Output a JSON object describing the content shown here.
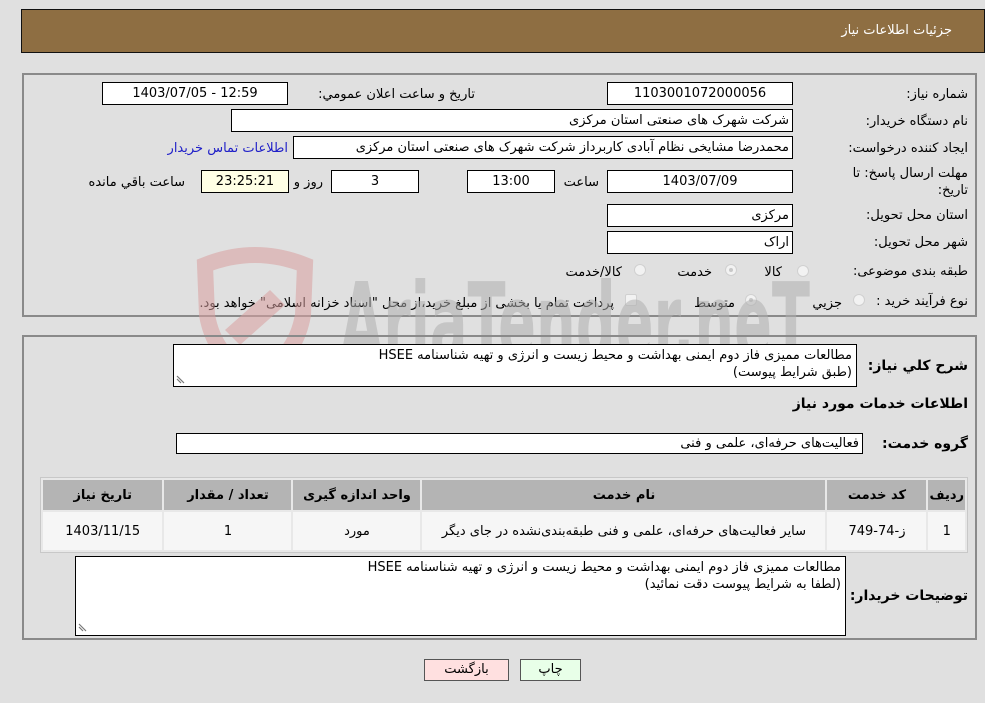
{
  "header": {
    "title": "جزئیات اطلاعات نیاز"
  },
  "form": {
    "need_number_label": "شماره نیاز:",
    "need_number": "1103001072000056",
    "announce_label": "تاریخ و ساعت اعلان عمومي:",
    "announce_value": "1403/07/05 - 12:59",
    "buyer_org_label": "نام دستگاه خریدار:",
    "buyer_org": "شرکت شهرک های صنعتی استان مرکزی",
    "creator_label": "ایجاد کننده درخواست:",
    "creator": "محمدرضا مشایخی نظام آبادی کاربرداز شرکت شهرک های صنعتی استان مرکزی",
    "contact_link": "اطلاعات تماس خریدار",
    "deadline_label_1": "مهلت ارسال پاسخ: تا",
    "deadline_label_2": "تاریخ:",
    "deadline_date": "1403/07/09",
    "time_label": "ساعت",
    "deadline_time": "13:00",
    "days": "3",
    "days_label": "روز و",
    "remaining": "23:25:21",
    "remaining_label": "ساعت باقي مانده",
    "province_label": "استان محل تحویل:",
    "province": "مرکزی",
    "city_label": "شهر محل تحویل:",
    "city": "اراک",
    "category_label": "طبقه بندی موضوعی:",
    "category_options": [
      {
        "label": "کالا",
        "selected": false
      },
      {
        "label": "خدمت",
        "selected": true
      },
      {
        "label": "کالا/خدمت",
        "selected": false
      }
    ],
    "process_label": "نوع فرآیند خرید :",
    "process_options": [
      {
        "label": "جزيي",
        "selected": false
      },
      {
        "label": "متوسط",
        "selected": true
      }
    ],
    "treasury_note": "پرداخت تمام یا بخشی از مبلغ خرید،از محل \"اسناد خزانه اسلامی\" خواهد بود."
  },
  "details": {
    "description_label": "شرح كلي نياز:",
    "description": "مطالعات ممیزی فاز دوم ایمنی بهداشت و محیط زیست و انرژی و تهیه شناسنامه HSEE\n(طبق شرایط پیوست)",
    "services_heading": "اطلاعات خدمات مورد نیاز",
    "service_group_label": "گروه خدمت:",
    "service_group": "فعالیت‌های حرفه‌ای، علمی و فنی",
    "table": {
      "headers": [
        "ردیف",
        "کد خدمت",
        "نام خدمت",
        "واحد اندازه گیری",
        "تعداد / مقدار",
        "تاریخ نیاز"
      ],
      "rows": [
        [
          "1",
          "ز-74-749",
          "سایر فعالیت‌های حرفه‌ای، علمی و فنی طبقه‌بندی‌نشده در جای دیگر",
          "مورد",
          "1",
          "1403/11/15"
        ]
      ]
    },
    "buyer_notes_label": "توضیحات خریدار:",
    "buyer_notes": "مطالعات ممیزی فاز دوم ایمنی بهداشت و محیط زیست و انرژی و تهیه شناسنامه HSEE\n(لطفا به شرایط پیوست دقت نمائید)"
  },
  "buttons": {
    "print": "چاپ",
    "back": "بازگشت"
  },
  "watermark": {
    "text": "AriaTender.neT"
  },
  "colors": {
    "header_bg": "#8e6e42",
    "link": "#2020c8",
    "back_btn": "#ffe0e0",
    "print_btn": "#e8ffe8"
  }
}
